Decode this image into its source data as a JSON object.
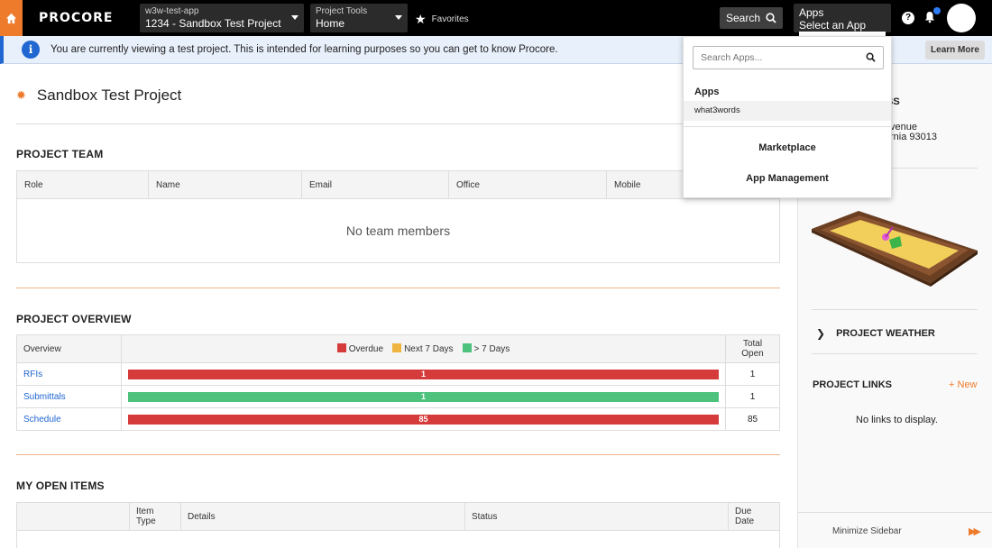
{
  "topnav": {
    "logo": "PROCORE",
    "company_small": "w3w-test-app",
    "company_big": "1234 - Sandbox Test Project",
    "tool_small": "Project Tools",
    "tool_big": "Home",
    "favorites": "Favorites",
    "search": "Search",
    "apps_small": "Apps",
    "apps_big": "Select an App",
    "help": "?"
  },
  "banner": {
    "icon": "i",
    "text": "You are currently viewing a test project. This is intended for learning purposes so you can get to know Procore.",
    "learn_more": "Learn More"
  },
  "project": {
    "title": "Sandbox Test Project"
  },
  "team": {
    "title": "PROJECT TEAM",
    "columns": [
      "Role",
      "Name",
      "Email",
      "Office",
      "Mobile"
    ],
    "empty": "No team members"
  },
  "overview": {
    "title": "PROJECT OVERVIEW",
    "col_overview": "Overview",
    "col_total": "Total Open",
    "legend": [
      {
        "label": "Overdue",
        "color": "#d63b3b"
      },
      {
        "label": "Next 7 Days",
        "color": "#f0b440"
      },
      {
        "label": "> 7 Days",
        "color": "#4cc27d"
      }
    ],
    "rows": [
      {
        "name": "RFIs",
        "bar_label": "1",
        "bar_color": "#d63b3b",
        "total": "1"
      },
      {
        "name": "Submittals",
        "bar_label": "1",
        "bar_color": "#4cc27d",
        "total": "1"
      },
      {
        "name": "Schedule",
        "bar_label": "85",
        "bar_color": "#d63b3b",
        "total": "85"
      }
    ]
  },
  "open_items": {
    "title": "MY OPEN ITEMS",
    "columns": [
      "",
      "Item Type",
      "Details",
      "Status",
      "Due Date"
    ]
  },
  "sidebar": {
    "address_title_partial": "SS",
    "address_line1_partial": "venue",
    "address_line2_partial": "rnia 93013",
    "weather": "PROJECT WEATHER",
    "links_title": "PROJECT LINKS",
    "new_link": "+ New",
    "no_links": "No links to display.",
    "minimize": "Minimize Sidebar"
  },
  "apps_dropdown": {
    "placeholder": "Search Apps...",
    "label": "Apps",
    "items": [
      "what3words"
    ],
    "marketplace": "Marketplace",
    "management": "App Management"
  }
}
